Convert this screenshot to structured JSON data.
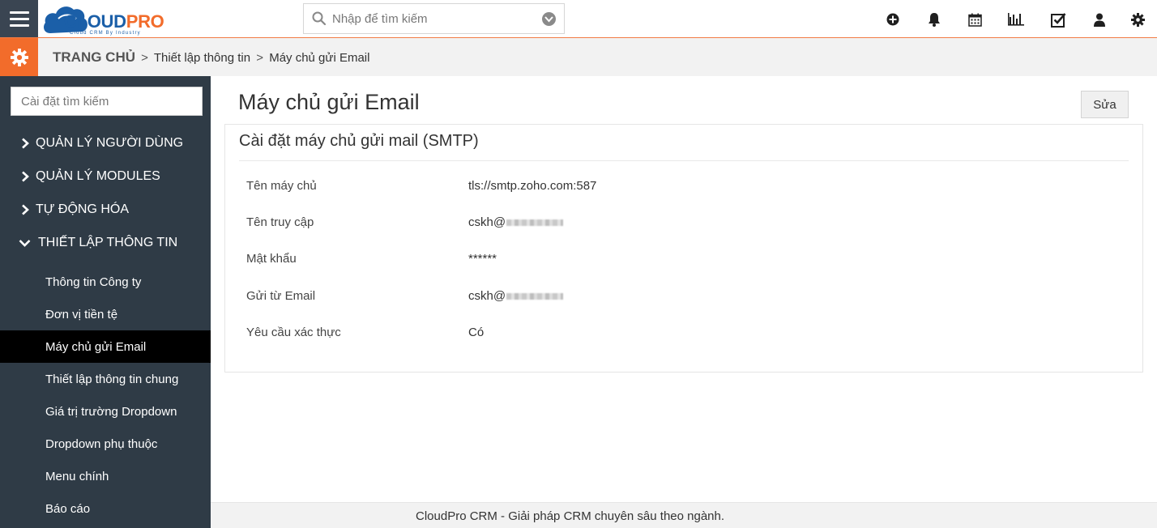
{
  "header": {
    "logo": {
      "brand_part1": "CLOUD",
      "brand_part2": "PRO",
      "tagline": "Cloud CRM By Industry"
    },
    "search": {
      "placeholder": "Nhập để tìm kiếm"
    },
    "icons": [
      "plus-circle-icon",
      "bell-icon",
      "calendar-icon",
      "bar-chart-icon",
      "checkbox-icon",
      "user-icon",
      "gear-icon"
    ],
    "colors": {
      "accent": "#f26c2b",
      "dark": "#3a4552",
      "brand_blue": "#1b5fa8"
    }
  },
  "breadcrumb": {
    "home": "TRANG CHỦ",
    "separator": ">",
    "items": [
      "Thiết lập thông tin",
      "Máy chủ gửi Email"
    ]
  },
  "sidebar": {
    "search_placeholder": "Cài đặt tìm kiếm",
    "sections": [
      {
        "label": "QUẢN LÝ NGƯỜI DÙNG",
        "expanded": false
      },
      {
        "label": "QUẢN LÝ MODULES",
        "expanded": false
      },
      {
        "label": "TỰ ĐỘNG HÓA",
        "expanded": false
      },
      {
        "label": "THIẾT LẬP THÔNG TIN",
        "expanded": true
      }
    ],
    "sub_items": [
      {
        "label": "Thông tin Công ty",
        "active": false
      },
      {
        "label": "Đơn vị tiền tệ",
        "active": false
      },
      {
        "label": "Máy chủ gửi Email",
        "active": true
      },
      {
        "label": "Thiết lập thông tin chung",
        "active": false
      },
      {
        "label": "Giá trị trường Dropdown",
        "active": false
      },
      {
        "label": "Dropdown phụ thuộc",
        "active": false
      },
      {
        "label": "Menu chính",
        "active": false
      },
      {
        "label": "Báo cáo",
        "active": false
      }
    ]
  },
  "main": {
    "title": "Máy chủ gửi Email",
    "edit_button": "Sửa",
    "panel": {
      "title": "Cài đặt máy chủ gửi mail (SMTP)",
      "rows": [
        {
          "label": "Tên máy chủ",
          "value": "tls://smtp.zoho.com:587",
          "obscured": false
        },
        {
          "label": "Tên truy cập",
          "value": "cskh@",
          "obscured": true
        },
        {
          "label": "Mật khẩu",
          "value": "******",
          "obscured": false
        },
        {
          "label": "Gửi từ Email",
          "value": "cskh@",
          "obscured": true
        },
        {
          "label": "Yêu cầu xác thực",
          "value": "Có",
          "obscured": false
        }
      ]
    }
  },
  "footer": {
    "text": "CloudPro CRM - Giải pháp CRM chuyên sâu theo ngành."
  }
}
